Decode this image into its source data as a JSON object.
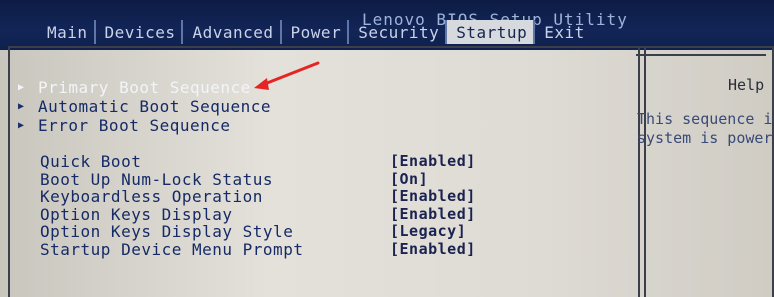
{
  "app_title": "Lenovo BIOS Setup Utility",
  "tabs": [
    {
      "label": "Main"
    },
    {
      "label": "Devices"
    },
    {
      "label": "Advanced"
    },
    {
      "label": "Power"
    },
    {
      "label": "Security"
    },
    {
      "label": "Startup",
      "active": true
    },
    {
      "label": "Exit"
    }
  ],
  "boot_menu": [
    {
      "label": "Primary Boot Sequence"
    },
    {
      "label": "Automatic Boot Sequence"
    },
    {
      "label": "Error Boot Sequence"
    }
  ],
  "settings": [
    {
      "label": "Quick Boot",
      "value": "[Enabled]"
    },
    {
      "label": "Boot Up Num-Lock Status",
      "value": "[On]"
    },
    {
      "label": "Keyboardless Operation",
      "value": "[Enabled]"
    },
    {
      "label": "Option Keys Display",
      "value": "[Enabled]"
    },
    {
      "label": "Option Keys Display Style",
      "value": "[Legacy]"
    },
    {
      "label": "Startup Device Menu Prompt",
      "value": "[Enabled]"
    }
  ],
  "help": {
    "title": "Help",
    "text": "This sequence i\nsystem is power"
  },
  "colors": {
    "title_bar": "#122557",
    "background": "#dedbd4",
    "highlight_text": "#f2f4f8",
    "menu_text": "#152a66",
    "annotation_arrow": "#e52424"
  },
  "icons": {
    "submenu_marker": "triangle-right-icon",
    "annotation": "red-arrow-icon"
  }
}
